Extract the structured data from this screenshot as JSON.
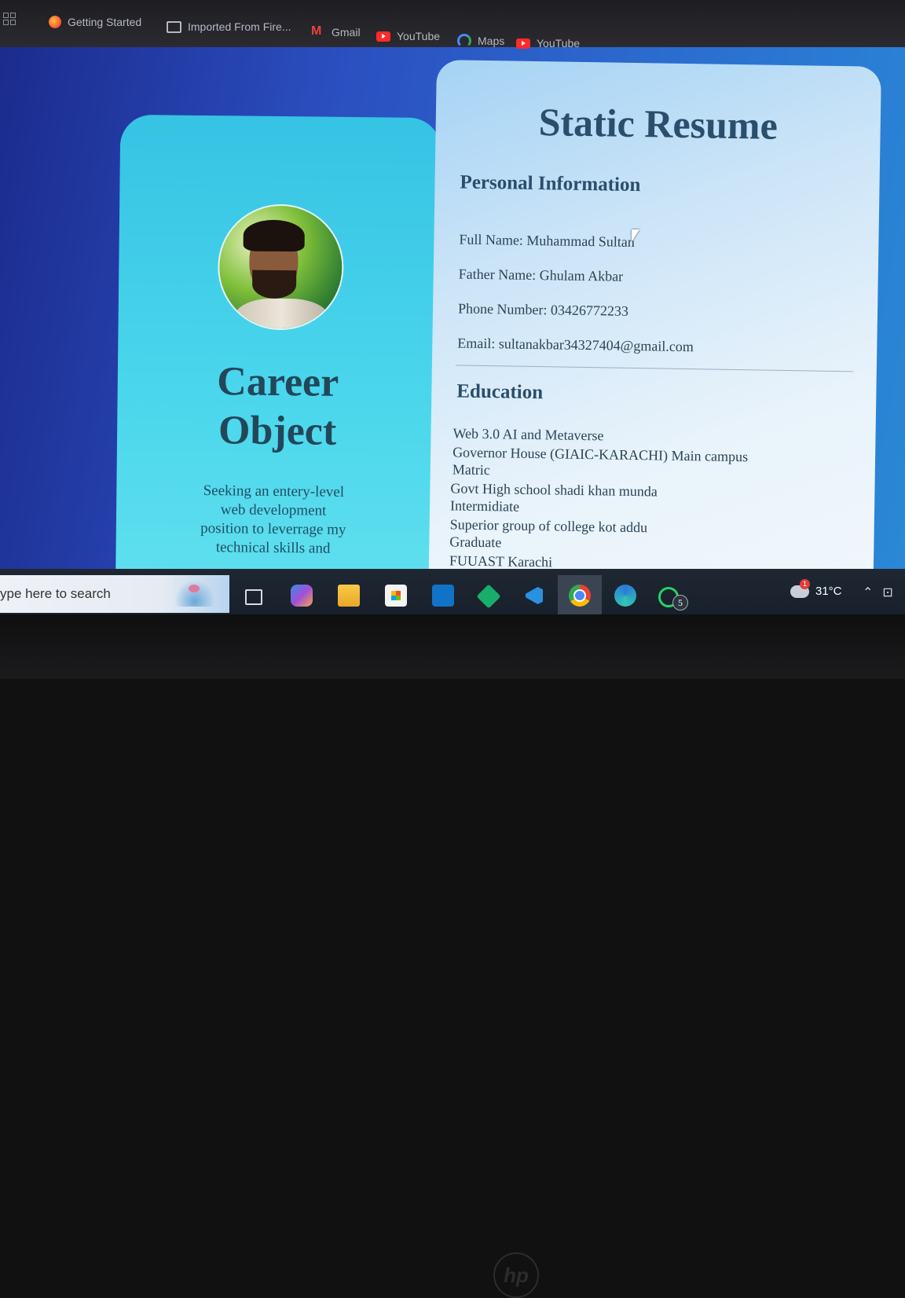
{
  "bookmarks": {
    "items": [
      {
        "label": "Getting Started",
        "icon": "firefox-icon"
      },
      {
        "label": "Imported From Fire...",
        "icon": "folder-icon"
      },
      {
        "label": "Gmail",
        "icon": "gmail-icon"
      },
      {
        "label": "YouTube",
        "icon": "youtube-icon"
      },
      {
        "label": "Maps",
        "icon": "maps-icon"
      },
      {
        "label": "YouTube",
        "icon": "youtube-icon"
      }
    ]
  },
  "left_card": {
    "title_line1": "Career",
    "title_line2": "Object",
    "description": "Seeking an entery-level web development position to leverrage my technical skills and"
  },
  "resume": {
    "title": "Static Resume",
    "personal_heading": "Personal Information",
    "full_name": "Full Name: Muhammad Sultan",
    "father_name": "Father Name: Ghulam Akbar",
    "phone": "Phone Number: 03426772233",
    "email": "Email: sultanakbar34327404@gmail.com",
    "education_heading": "Education",
    "education": [
      "Web 3.0 AI and Metaverse",
      "Governor House (GIAIC-KARACHI) Main campus",
      "Matric",
      "Govt High school shadi khan munda",
      "Intermidiate",
      "Superior group of college kot addu",
      "Graduate",
      "FUUAST Karachi"
    ]
  },
  "taskbar": {
    "search_placeholder": "ype here to search",
    "whatsapp_badge": "5",
    "temperature": "31°C"
  },
  "colors": {
    "heading": "#2a4e6b",
    "left_card": "#45d0ea",
    "right_card": "#e8f3fb"
  }
}
